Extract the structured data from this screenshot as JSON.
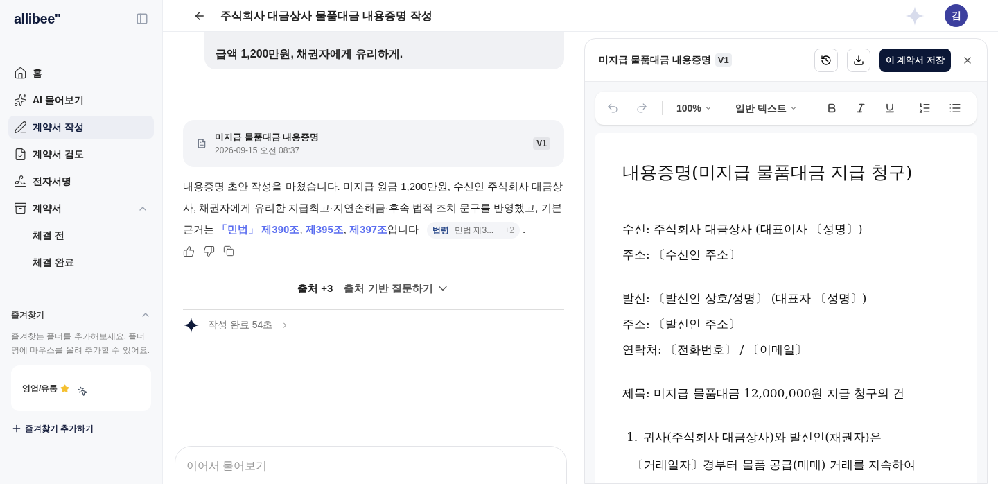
{
  "sidebar": {
    "logo": "allibee\"",
    "nav": [
      {
        "label": "홈",
        "selected": false
      },
      {
        "label": "AI 물어보기",
        "selected": false
      },
      {
        "label": "계약서 작성",
        "selected": true
      },
      {
        "label": "계약서 검토",
        "selected": false
      },
      {
        "label": "전자서명",
        "selected": false
      },
      {
        "label": "계약서",
        "selected": false,
        "expanded": true,
        "children": [
          {
            "label": "체결 전"
          },
          {
            "label": "체결 완료"
          }
        ]
      }
    ],
    "favorites": {
      "title": "즐겨찾기",
      "expanded": true,
      "hint": "즐겨찾는 폴더를 추가해보세요. 폴더명에 마우스를 올려 추가할 수 있어요.",
      "items": [
        {
          "label": "영업/유통",
          "starred": true
        }
      ],
      "add": "즐겨찾기 추가하기"
    }
  },
  "header": {
    "title": "주식회사 대금상사 물품대금 내용증명 작성",
    "avatar": "김"
  },
  "chat": {
    "user_message": "급액 1,200만원, 채권자에게 유리하게.",
    "doc_card": {
      "title": "미지급 물품대금 내용증명",
      "date": "2026-09-15 오전 08:37",
      "version": "V1"
    },
    "answer": {
      "text": "내용증명 초안 작성을 마쳤습니다. 미지급 원금 1,200만원, 수신인 주식회사 대금상사, 채권자에게 유리한 지급최고·지연손해금·후속 법적 조치 문구를 반영했고, 기본 근거는 ",
      "links": [
        "「민법」 제390조",
        "제395조",
        "제397조"
      ],
      "separator": ",",
      "tail": "입니다",
      "chip": {
        "tag": "법령",
        "label": "민법 제3...",
        "more": "+2"
      },
      "end": "."
    },
    "sources": "출처 +3",
    "source_question": "출처 기반 질문하기",
    "done": "작성 완료 54초",
    "composer_placeholder": "이어서 물어보기"
  },
  "editor": {
    "title": "미지급 물품대금 내용증명",
    "version": "V1",
    "save": "이 계약서 저장",
    "zoom": "100%",
    "style": "일반 텍스트",
    "doc_title": "내용증명(미지급 물품대금 지급 청구)",
    "blocks": [
      {
        "kind": "line",
        "text": "수신: 주식회사 대금상사 (대표이사 〔성명〕)"
      },
      {
        "kind": "line",
        "text": "주소: 〔수신인 주소〕"
      },
      {
        "kind": "gap"
      },
      {
        "kind": "line",
        "text": "발신: 〔발신인 상호/성명〕 (대표자 〔성명〕)"
      },
      {
        "kind": "line",
        "text": "주소: 〔발신인 주소〕"
      },
      {
        "kind": "line",
        "text": "연락처: 〔전화번호〕 / 〔이메일〕"
      },
      {
        "kind": "gap"
      },
      {
        "kind": "line",
        "text": "제목: 미지급 물품대금 12,000,000원 지급 청구의 건"
      },
      {
        "kind": "gap"
      },
      {
        "kind": "numbered",
        "number": "1.",
        "lines": [
          "귀사(주식회사 대금상사)와 발신인(채권자)은",
          "〔거래일자〕경부터 물품 공급(매매) 거래를 지속하여"
        ]
      }
    ]
  }
}
